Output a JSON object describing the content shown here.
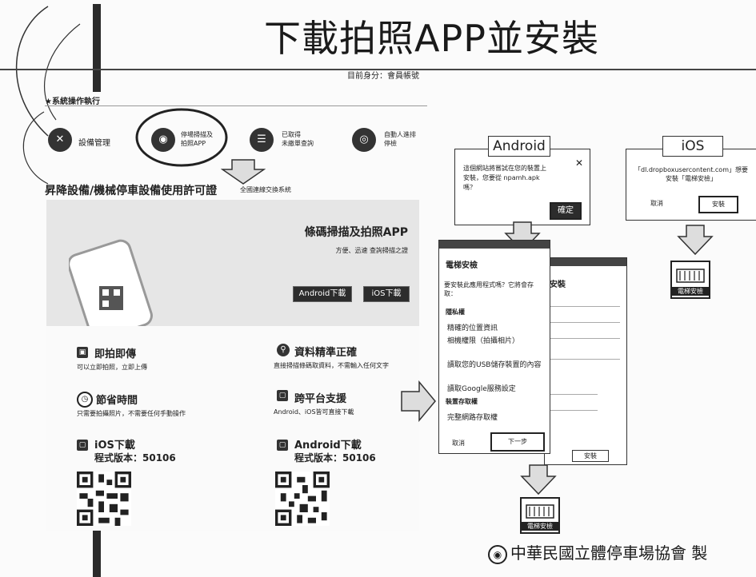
{
  "title": "下載拍照APP並安裝",
  "footer": "中華民國立體停車場協會 製",
  "web": {
    "user_info": "目前身分：會員帳號",
    "nav_label": "★系統操作執行",
    "menu": [
      {
        "label": "設備管理",
        "icon": "wrench-icon"
      },
      {
        "label": "停場掃描及\n拍照APP",
        "icon": "camera-icon"
      },
      {
        "label": "已取得\n未繳單查詢",
        "icon": "list-icon"
      },
      {
        "label": "自動人進排\n停檢",
        "icon": "eye-icon"
      }
    ],
    "system_name": "昇降設備/機械停車設備使用許可證",
    "system_sub": "全國連線交換系統",
    "banner_title": "條碼掃描及拍照APP",
    "banner_sub": "方便、迅速 查詢掃描之證",
    "android_btn": "Android下載",
    "ios_btn": "iOS下載",
    "features": [
      {
        "title": "即拍即傳",
        "desc": "可以立即拍照，立即上傳",
        "icon": "photo-icon"
      },
      {
        "title": "資料精準正確",
        "desc": "直接掃描條碼取資料，不需輸入任何文字",
        "icon": "person-pin-icon"
      },
      {
        "title": "節省時間",
        "desc": "只需要拍攝照片，不需要任何手動操作",
        "icon": "clock-icon"
      },
      {
        "title": "跨平台支援",
        "desc": "Android、iOS皆可直接下載",
        "icon": "device-icon"
      }
    ],
    "ios_dl": {
      "title": "iOS下載",
      "version": "程式版本：50106"
    },
    "android_dl": {
      "title": "Android下載",
      "version": "程式版本：50106"
    }
  },
  "android": {
    "tag": "Android",
    "prompt": "這個網站將嘗試在您的裝置上\n安裝，您要從 npamh.apk\n嗎？",
    "confirm": "確定",
    "install_title": "電梯安檢",
    "install_q": "要安裝此應用程式嗎？它將會存取：",
    "section": "隱私權",
    "perms": [
      "精確的位置資訊",
      "相機權限（拍攝相片）",
      "讀取您的USB儲存裝置的內容",
      "讀取Google服務設定"
    ],
    "section2": "裝置存取權",
    "perm_last": "完整網路存取權",
    "cancel": "取消",
    "next": "下一步",
    "back_title": "安裝",
    "back_install": "安裝",
    "app_name": "電梯安檢"
  },
  "ios": {
    "tag": "iOS",
    "prompt": "「dl.dropboxusercontent.com」想要安裝「電梯安檢」",
    "cancel": "取消",
    "install": "安裝",
    "app_name": "電梯安檢"
  }
}
